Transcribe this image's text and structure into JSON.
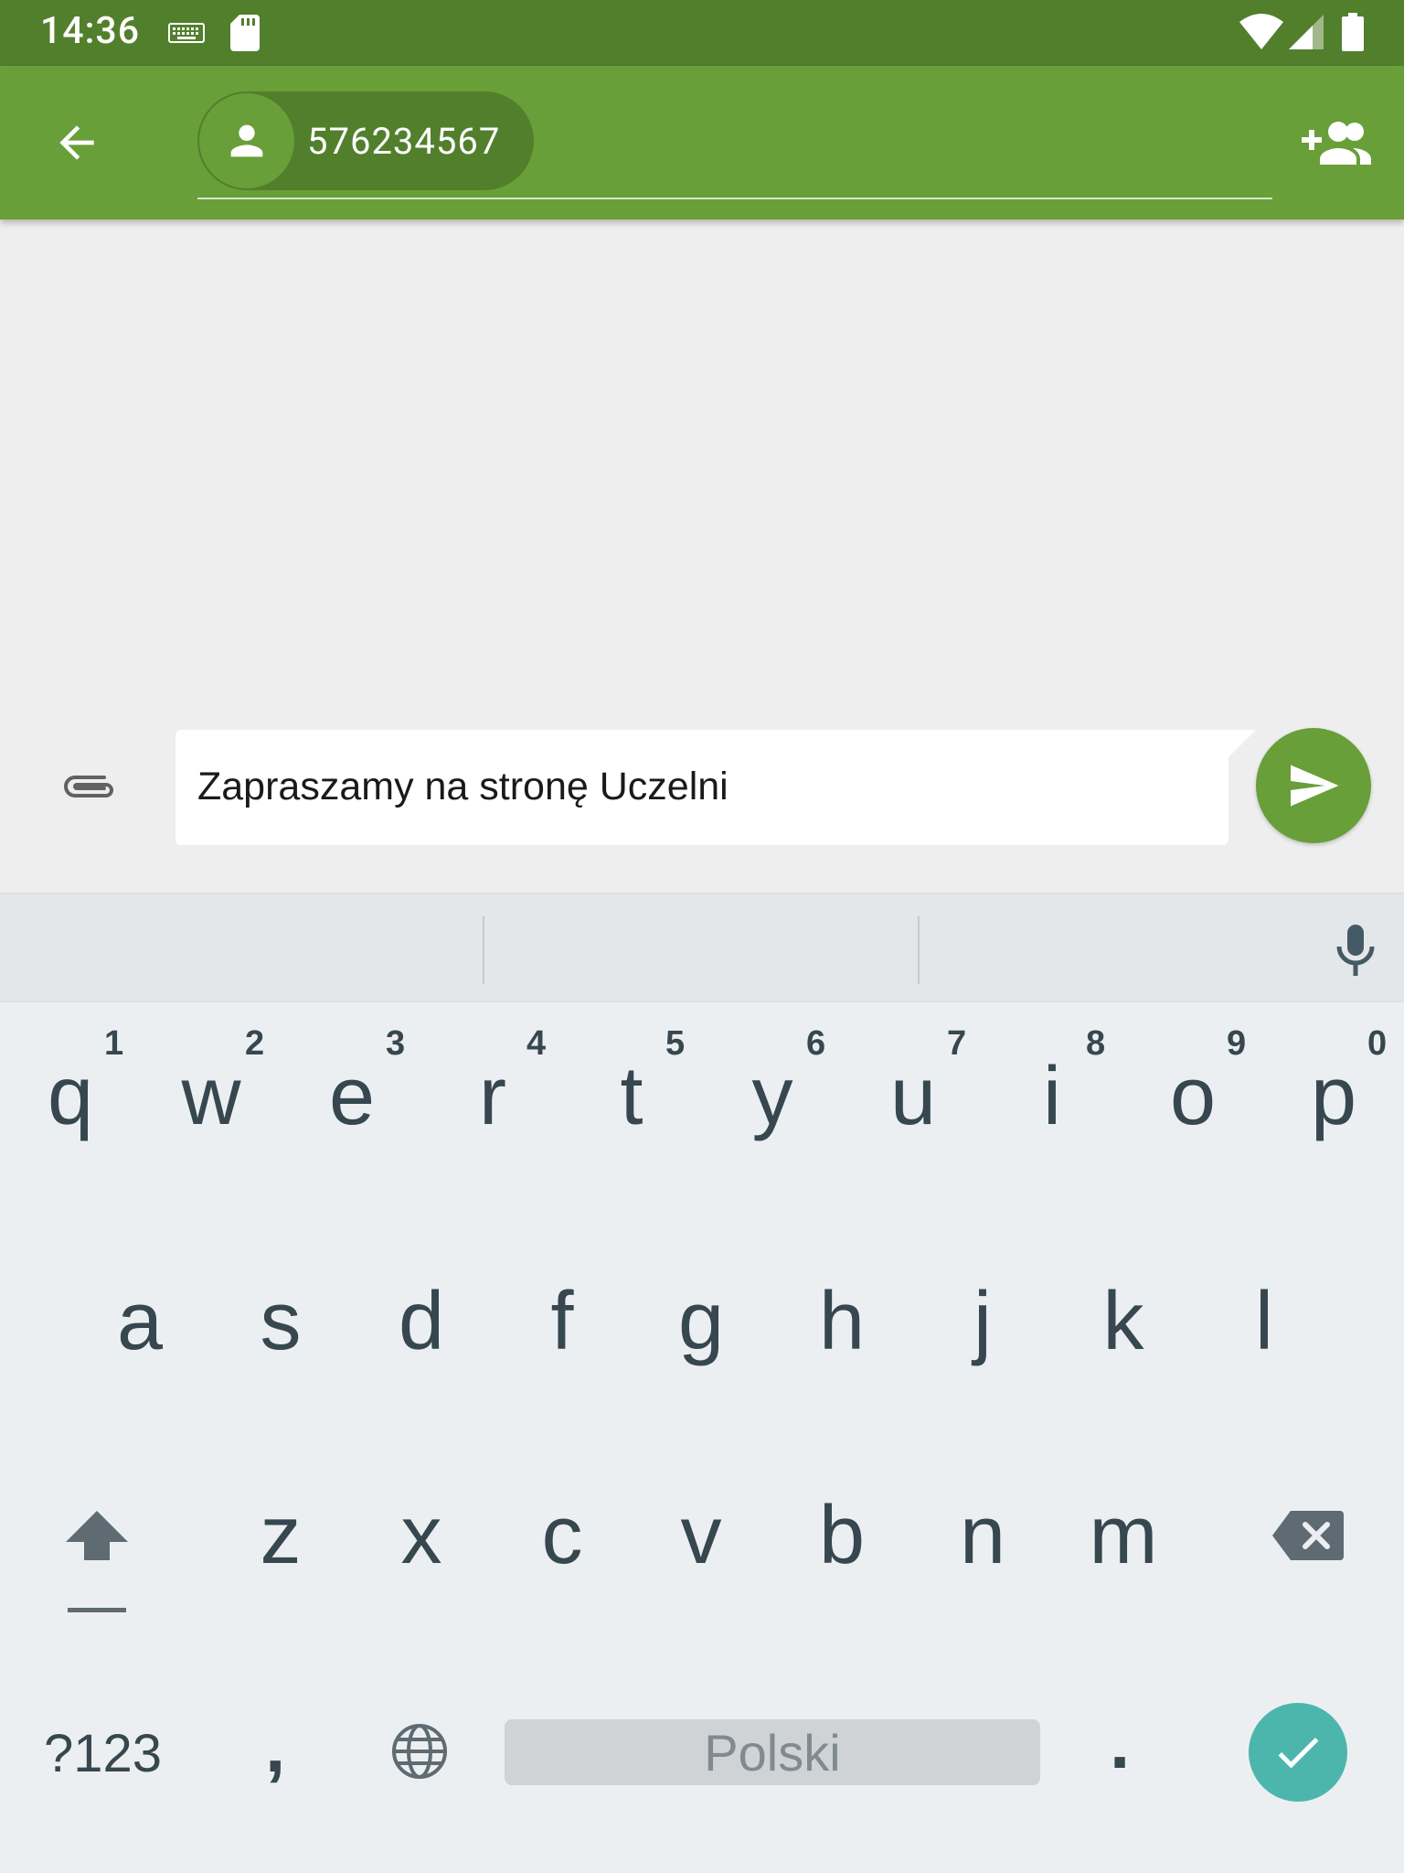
{
  "status_bar": {
    "time": "14:36",
    "icons": [
      "keyboard-icon",
      "sd-card-icon",
      "wifi-icon",
      "signal-icon",
      "battery-icon"
    ]
  },
  "app_bar": {
    "recipient_number": "576234567",
    "back_icon": "arrow-back-icon",
    "add_contact_icon": "add-group-icon"
  },
  "compose": {
    "message_text": "Zapraszamy na stronę Uczelni",
    "attach_icon": "paperclip-icon",
    "send_icon": "send-icon"
  },
  "keyboard": {
    "row1": [
      {
        "letter": "q",
        "hint": "1"
      },
      {
        "letter": "w",
        "hint": "2"
      },
      {
        "letter": "e",
        "hint": "3"
      },
      {
        "letter": "r",
        "hint": "4"
      },
      {
        "letter": "t",
        "hint": "5"
      },
      {
        "letter": "y",
        "hint": "6"
      },
      {
        "letter": "u",
        "hint": "7"
      },
      {
        "letter": "i",
        "hint": "8"
      },
      {
        "letter": "o",
        "hint": "9"
      },
      {
        "letter": "p",
        "hint": "0"
      }
    ],
    "row2": [
      "a",
      "s",
      "d",
      "f",
      "g",
      "h",
      "j",
      "k",
      "l"
    ],
    "row3": [
      "z",
      "x",
      "c",
      "v",
      "b",
      "n",
      "m"
    ],
    "symbols_label": "?123",
    "comma": ",",
    "space_label": "Polski",
    "period": "."
  },
  "colors": {
    "status_bar": "#527f2c",
    "app_bar": "#689f38",
    "send_button": "#689f38",
    "enter_button": "#4db6ac",
    "key_text": "#37474f"
  }
}
